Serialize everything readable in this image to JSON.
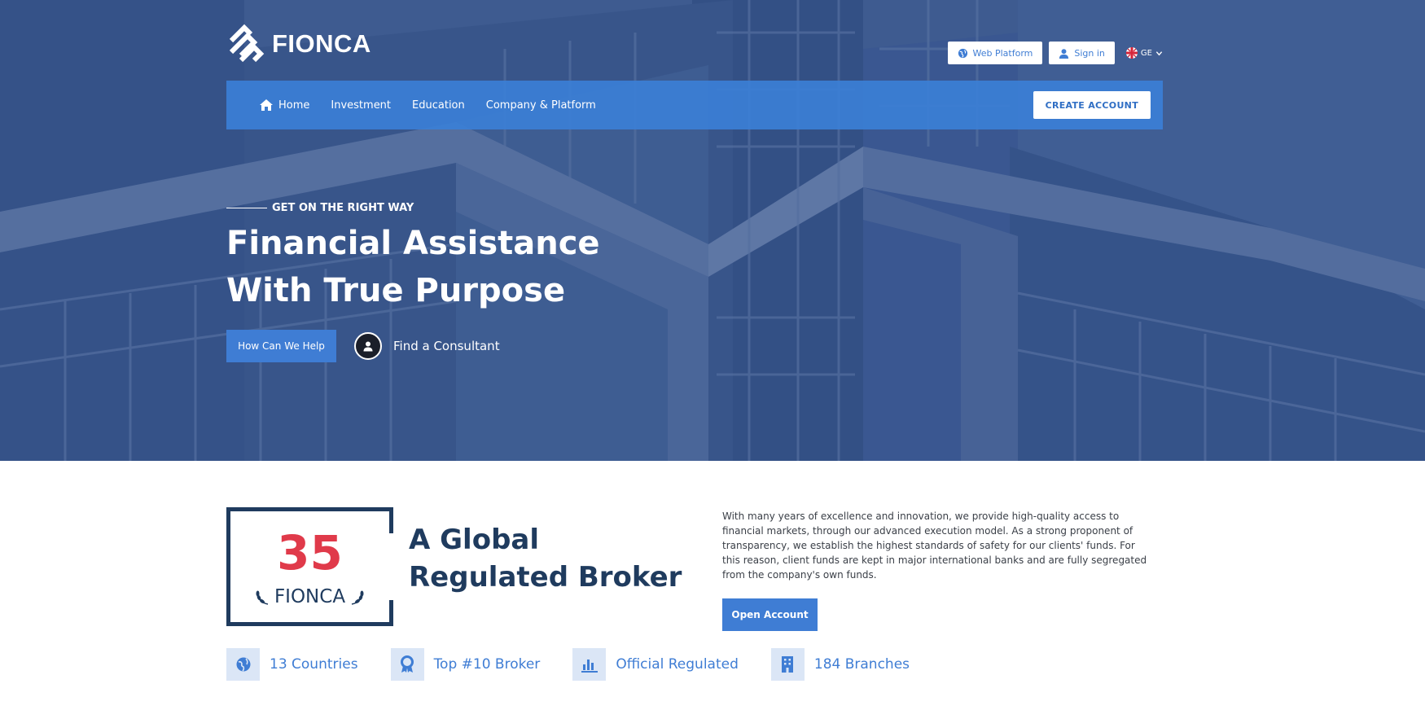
{
  "brand": {
    "name": "FIONCA"
  },
  "top_actions": {
    "web_platform": "Web Platform",
    "sign_in": "Sign in",
    "language": "GE"
  },
  "nav": {
    "items": [
      {
        "label": "Home",
        "icon": "home-icon"
      },
      {
        "label": "Investment"
      },
      {
        "label": "Education"
      },
      {
        "label": "Company & Platform"
      }
    ],
    "create_account": "CREATE ACCOUNT"
  },
  "hero": {
    "tagline": "GET ON THE RIGHT WAY",
    "headline_line1": "Financial Assistance",
    "headline_line2": "With True Purpose",
    "help_button": "How Can We Help",
    "consultant_link": "Find a Consultant"
  },
  "about": {
    "years": "35",
    "years_brand": "FIONCA",
    "title": "A Global Regulated Broker",
    "text": "With many years of excellence and innovation, we provide high-quality access to financial markets, through our advanced execution model. As a strong proponent of transparency, we establish the highest standards of safety for our clients' funds. For this reason, client funds are kept in major international banks and are fully segregated from the company's own funds.",
    "open_account": "Open Account"
  },
  "stats": [
    {
      "label": "13 Countries",
      "icon": "globe-icon"
    },
    {
      "label": "Top #10 Broker",
      "icon": "award-icon"
    },
    {
      "label": "Official Regulated",
      "icon": "chart-icon"
    },
    {
      "label": "184 Branches",
      "icon": "building-icon"
    }
  ],
  "colors": {
    "accent": "#3f7dd4",
    "navy": "#1f3b5e",
    "red": "#e03a4a"
  }
}
